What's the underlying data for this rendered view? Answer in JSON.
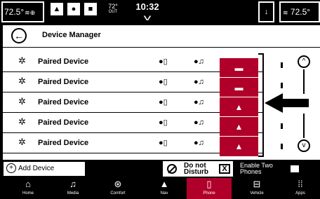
{
  "status": {
    "left_temp": "72.5°",
    "left_temp_icon": "seat-heat",
    "outside_temp": "72°",
    "outside_label": "OUT",
    "clock": "10:32",
    "right_temp": "72.5°",
    "right_temp_icon": "seat-heat"
  },
  "header": {
    "title": "Device Manager",
    "back_icon": "back-arrow"
  },
  "devices": [
    {
      "name": "Paired Device"
    },
    {
      "name": "Paired Device"
    },
    {
      "name": "Paired Device"
    },
    {
      "name": "Paired Device"
    },
    {
      "name": "Paired Device"
    }
  ],
  "actions": {
    "add_device_label": "Add Device",
    "dnd_label_line1": "Do not",
    "dnd_label_line2": "Disturb",
    "two_phones_line1": "Enable Two",
    "two_phones_line2": "Phones"
  },
  "nav": [
    {
      "label": "Home",
      "icon": "home-icon"
    },
    {
      "label": "Media",
      "icon": "media-icon"
    },
    {
      "label": "Comfort",
      "icon": "comfort-icon"
    },
    {
      "label": "Nav",
      "icon": "nav-icon"
    },
    {
      "label": "Phone",
      "icon": "phone-icon",
      "active": true
    },
    {
      "label": "Vehicle",
      "icon": "vehicle-icon"
    },
    {
      "label": "Apps",
      "icon": "apps-icon"
    }
  ],
  "colors": {
    "accent": "#b0002a"
  }
}
